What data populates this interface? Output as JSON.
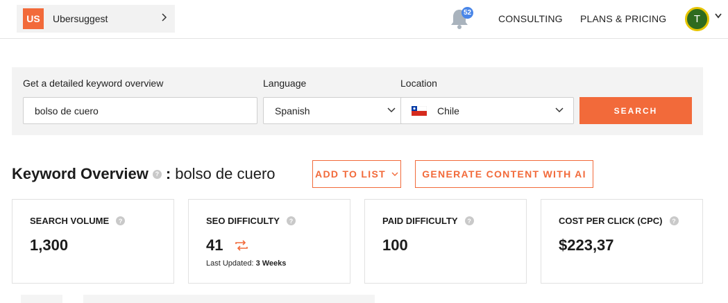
{
  "header": {
    "project_badge": "US",
    "project_name": "Ubersuggest",
    "notification_count": "52",
    "nav": [
      "CONSULTING",
      "PLANS & PRICING"
    ],
    "avatar_initial": "T"
  },
  "search": {
    "keyword_label": "Get a detailed keyword overview",
    "keyword_value": "bolso de cuero",
    "language_label": "Language",
    "language_value": "Spanish",
    "location_label": "Location",
    "location_value": "Chile",
    "search_button": "SEARCH"
  },
  "overview": {
    "title": "Keyword Overview",
    "separator": ":",
    "keyword": "bolso de cuero",
    "add_to_list": "ADD TO LIST",
    "generate_content": "GENERATE CONTENT WITH AI"
  },
  "metrics": [
    {
      "label": "SEARCH VOLUME",
      "value": "1,300"
    },
    {
      "label": "SEO DIFFICULTY",
      "value": "41",
      "updated_label": "Last Updated:",
      "updated_value": "3 Weeks"
    },
    {
      "label": "PAID DIFFICULTY",
      "value": "100"
    },
    {
      "label": "COST PER CLICK (CPC)",
      "value": "$223,37"
    }
  ],
  "colors": {
    "accent": "#f26a3a",
    "badge_blue": "#4a86e8",
    "avatar_green": "#2e6b1f",
    "avatar_ring": "#e6c400"
  },
  "icons": {
    "help": "?"
  }
}
